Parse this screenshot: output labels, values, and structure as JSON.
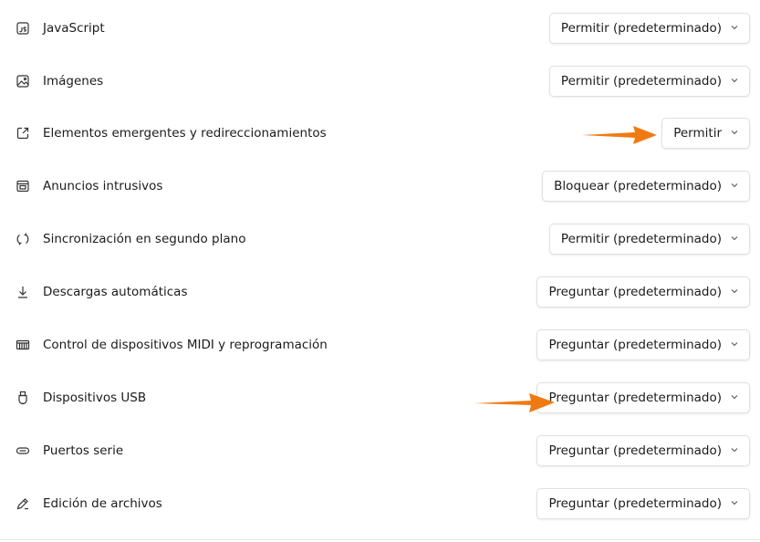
{
  "settings": [
    {
      "label": "JavaScript",
      "value": "Permitir (predeterminado)",
      "icon": "javascript-icon"
    },
    {
      "label": "Imágenes",
      "value": "Permitir (predeterminado)",
      "icon": "image-icon"
    },
    {
      "label": "Elementos emergentes y redireccionamientos",
      "value": "Permitir",
      "icon": "popup-open-icon"
    },
    {
      "label": "Anuncios intrusivos",
      "value": "Bloquear (predeterminado)",
      "icon": "ads-window-icon"
    },
    {
      "label": "Sincronización en segundo plano",
      "value": "Permitir (predeterminado)",
      "icon": "sync-icon"
    },
    {
      "label": "Descargas automáticas",
      "value": "Preguntar (predeterminado)",
      "icon": "download-icon"
    },
    {
      "label": "Control de dispositivos MIDI y reprogramación",
      "value": "Preguntar (predeterminado)",
      "icon": "midi-keyboard-icon"
    },
    {
      "label": "Dispositivos USB",
      "value": "Preguntar (predeterminado)",
      "icon": "usb-icon"
    },
    {
      "label": "Puertos serie",
      "value": "Preguntar (predeterminado)",
      "icon": "serial-port-icon"
    },
    {
      "label": "Edición de archivos",
      "value": "Preguntar (predeterminado)",
      "icon": "file-edit-icon"
    }
  ],
  "colors": {
    "arrow": "#f07a12",
    "border": "#e0e0e0",
    "text": "#1b1b1b"
  },
  "annotations": {
    "arrow_icon": "orange-arrow-icon"
  }
}
